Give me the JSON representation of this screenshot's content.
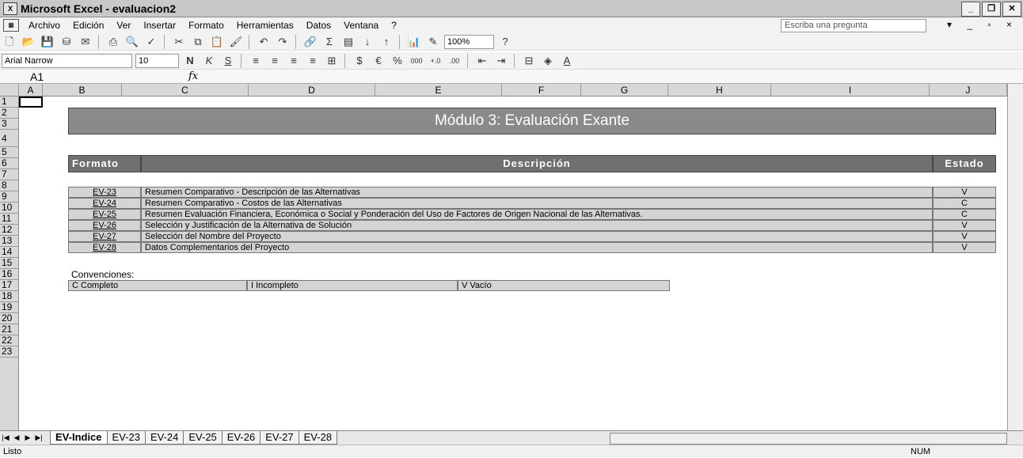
{
  "window": {
    "title": "Microsoft Excel - evaluacion2"
  },
  "menu": {
    "items": [
      "Archivo",
      "Edición",
      "Ver",
      "Insertar",
      "Formato",
      "Herramientas",
      "Datos",
      "Ventana",
      "?"
    ],
    "ask_placeholder": "Escriba una pregunta"
  },
  "toolbar": {
    "zoom": "100%",
    "font_name": "Arial Narrow",
    "font_size": "10"
  },
  "formula_bar": {
    "name_box": "A1",
    "fx_label": "fx"
  },
  "columns": [
    "A",
    "B",
    "C",
    "D",
    "E",
    "F",
    "G",
    "H",
    "I",
    "J"
  ],
  "rows": [
    "1",
    "2",
    "3",
    "4",
    "5",
    "6",
    "7",
    "8",
    "9",
    "10",
    "11",
    "12",
    "13",
    "14",
    "15",
    "16",
    "17",
    "18",
    "19",
    "20",
    "21",
    "22",
    "23"
  ],
  "sheet": {
    "banner": "Módulo 3: Evaluación Exante",
    "headers": {
      "format": "Formato",
      "description": "Descripción",
      "status": "Estado"
    },
    "items": [
      {
        "code": "EV-23",
        "description": "Resumen Comparativo - Descripción de las Alternativas",
        "status": "V"
      },
      {
        "code": "EV-24",
        "description": "Resumen Comparativo - Costos de las Alternativas",
        "status": "C"
      },
      {
        "code": "EV-25",
        "description": "Resumen Evaluación Financiera, Económica o Social y Ponderación del Uso de Factores de Origen Nacional de las Alternativas.",
        "status": "C"
      },
      {
        "code": "EV-26",
        "description": "Selección y Justificación de la Alternativa de Solución",
        "status": "V"
      },
      {
        "code": "EV-27",
        "description": "Selección del Nombre del Proyecto",
        "status": "V"
      },
      {
        "code": "EV-28",
        "description": "Datos Complementarios del Proyecto",
        "status": "V"
      }
    ],
    "conventions": {
      "title": "Convenciones:",
      "values": [
        "C  Completo",
        "I  Incompleto",
        "V  Vacío"
      ]
    }
  },
  "tabs": [
    "EV-Indice",
    "EV-23",
    "EV-24",
    "EV-25",
    "EV-26",
    "EV-27",
    "EV-28"
  ],
  "status": {
    "left": "Listo",
    "right": "NUM"
  }
}
